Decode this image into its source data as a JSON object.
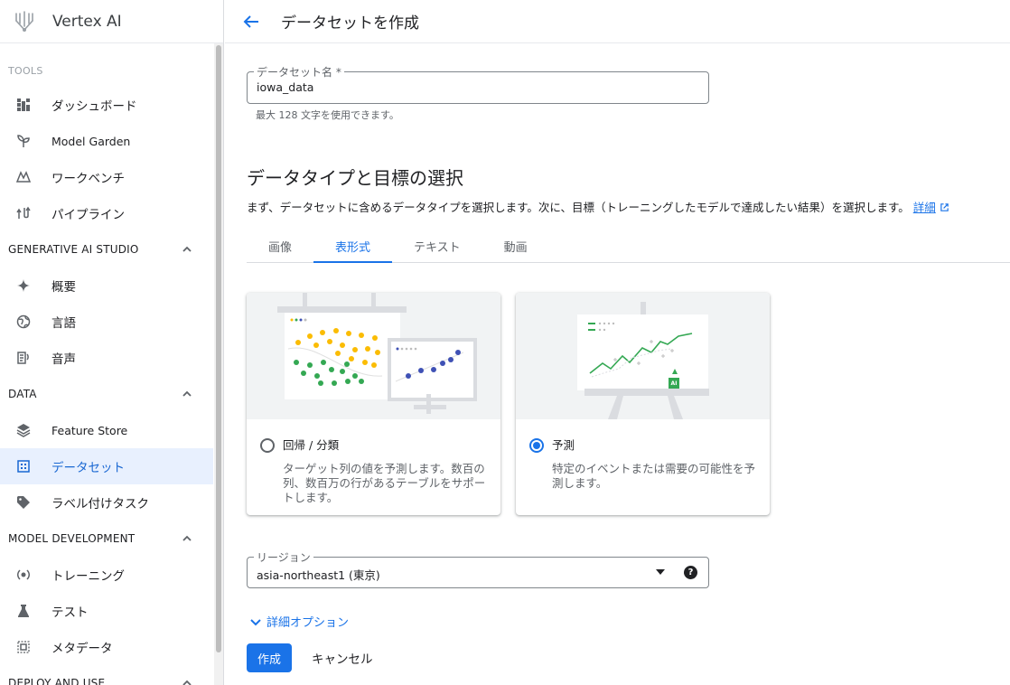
{
  "app": {
    "name": "Vertex AI"
  },
  "sidebar": {
    "tools_label": "TOOLS",
    "tools": [
      {
        "label": "ダッシュボード"
      },
      {
        "label": "Model Garden"
      },
      {
        "label": "ワークベンチ"
      },
      {
        "label": "パイプライン"
      }
    ],
    "sections": [
      {
        "title": "GENERATIVE AI STUDIO",
        "items": [
          {
            "label": "概要"
          },
          {
            "label": "言語"
          },
          {
            "label": "音声"
          }
        ]
      },
      {
        "title": "DATA",
        "items": [
          {
            "label": "Feature Store"
          },
          {
            "label": "データセット"
          },
          {
            "label": "ラベル付けタスク"
          }
        ]
      },
      {
        "title": "MODEL DEVELOPMENT",
        "items": [
          {
            "label": "トレーニング"
          },
          {
            "label": "テスト"
          },
          {
            "label": "メタデータ"
          }
        ]
      },
      {
        "title": "DEPLOY AND USE"
      }
    ],
    "active_item": "データセット"
  },
  "header": {
    "title": "データセットを作成"
  },
  "dataset_name": {
    "label": "データセット名 *",
    "value": "iowa_data",
    "hint": "最大 128 文字を使用できます。"
  },
  "data_type": {
    "title": "データタイプと目標の選択",
    "description": "まず、データセットに含めるデータタイプを選択します。次に、目標（トレーニングしたモデルで達成したい結果）を選択します。",
    "learn_more": "詳細",
    "tabs": [
      {
        "label": "画像"
      },
      {
        "label": "表形式"
      },
      {
        "label": "テキスト"
      },
      {
        "label": "動画"
      }
    ],
    "active_tab": "表形式",
    "options": [
      {
        "title": "回帰 / 分類",
        "description": "ターゲット列の値を予測します。数百の列、数百万の行があるテーブルをサポートします。",
        "selected": false
      },
      {
        "title": "予測",
        "description": "特定のイベントまたは需要の可能性を予測します。",
        "selected": true,
        "badge": "AI"
      }
    ]
  },
  "region": {
    "label": "リージョン",
    "value": "asia-northeast1 (東京)"
  },
  "advanced_options": {
    "label": "詳細オプション"
  },
  "actions": {
    "create": "作成",
    "cancel": "キャンセル"
  },
  "colors": {
    "accent": "#1a73e8",
    "active_bg": "#e8f0fe",
    "dot_yellow": "#fbbc04",
    "dot_green": "#34a853",
    "dot_blue": "#3f51b5",
    "line_green": "#34a853"
  }
}
